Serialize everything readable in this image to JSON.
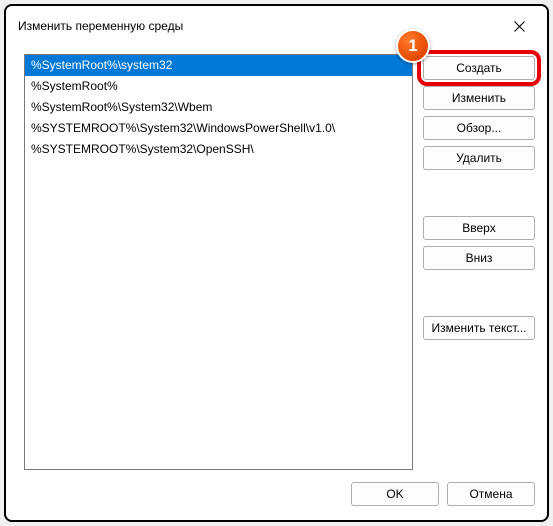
{
  "window": {
    "title": "Изменить переменную среды"
  },
  "marker": {
    "label": "1"
  },
  "paths": [
    {
      "value": "%SystemRoot%\\system32",
      "selected": true
    },
    {
      "value": "%SystemRoot%",
      "selected": false
    },
    {
      "value": "%SystemRoot%\\System32\\Wbem",
      "selected": false
    },
    {
      "value": "%SYSTEMROOT%\\System32\\WindowsPowerShell\\v1.0\\",
      "selected": false
    },
    {
      "value": "%SYSTEMROOT%\\System32\\OpenSSH\\",
      "selected": false
    }
  ],
  "buttons": {
    "create": "Создать",
    "edit": "Изменить",
    "browse": "Обзор...",
    "delete": "Удалить",
    "up": "Вверх",
    "down": "Вниз",
    "edit_text": "Изменить текст...",
    "ok": "OK",
    "cancel": "Отмена"
  }
}
